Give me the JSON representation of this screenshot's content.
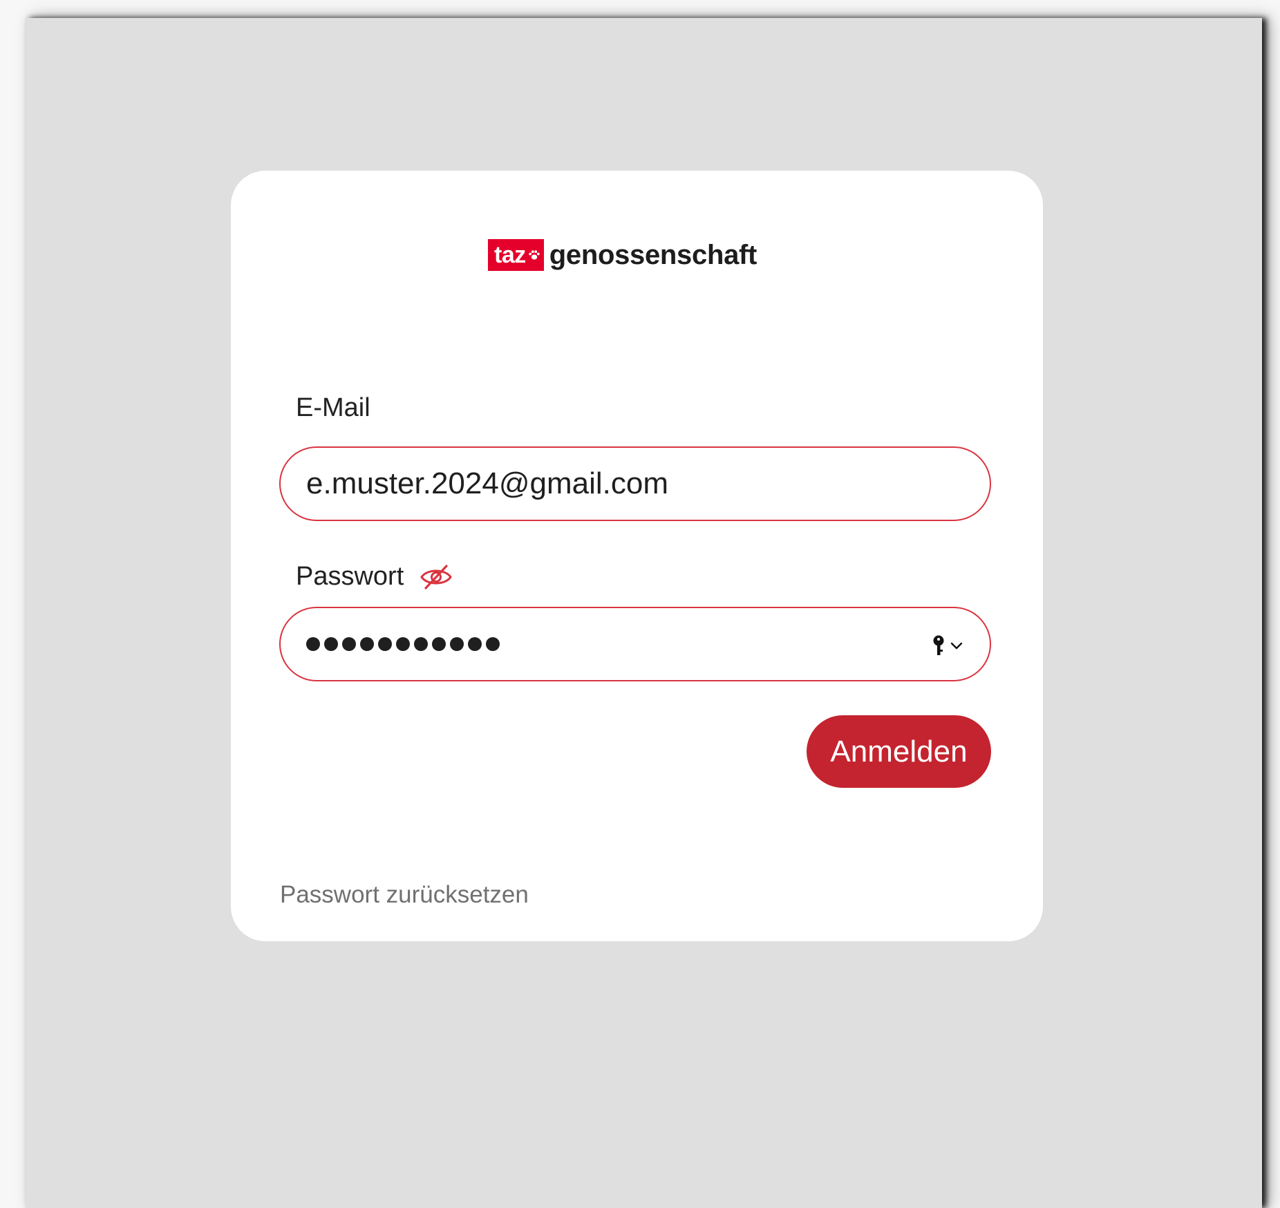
{
  "brand": {
    "logo_box_text": "taz",
    "logo_word": "genossenschaft",
    "accent_color": "#e4002b"
  },
  "form": {
    "email_label": "E-Mail",
    "email_value": "e.muster.2024@gmail.com",
    "password_label": "Passwort",
    "password_length": 11,
    "password_visibility_icon": "eye-slash-icon",
    "password_manager_icon": "key-icon",
    "submit_label": "Anmelden",
    "submit_color": "#c4242f",
    "field_border_color": "#d9343f"
  },
  "footer": {
    "reset_link": "Passwort zurücksetzen"
  }
}
